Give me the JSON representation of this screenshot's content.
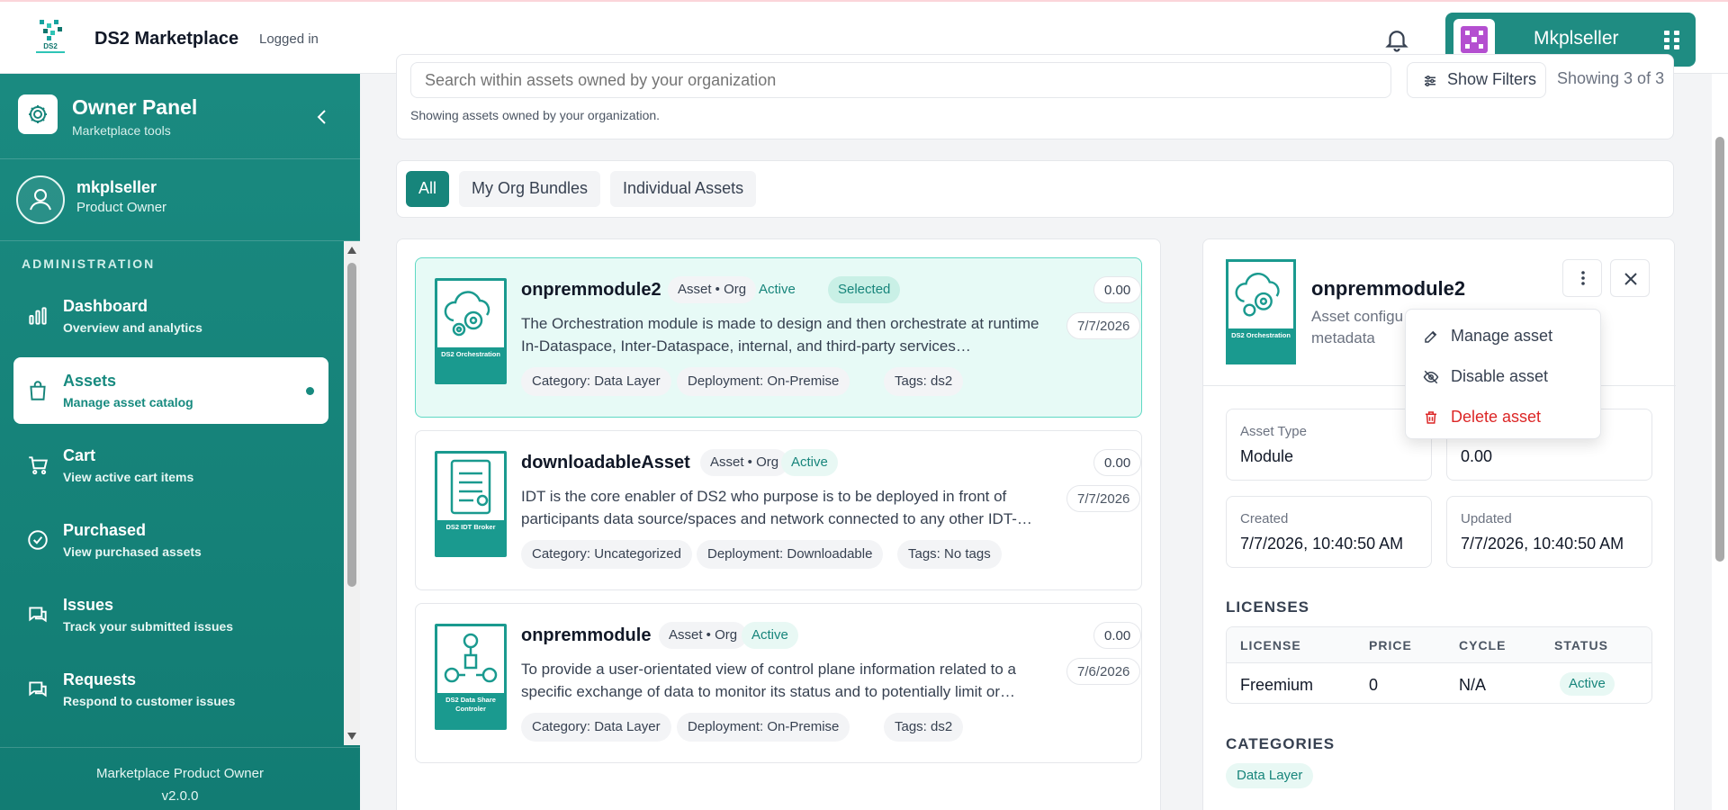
{
  "header": {
    "logo_text": "DS2",
    "app_title": "DS2 Marketplace",
    "login_status": "Logged in",
    "user_name": "Mkplseller"
  },
  "sidebar": {
    "panel_title": "Owner Panel",
    "panel_subtitle": "Marketplace tools",
    "user": {
      "name": "mkplseller",
      "role": "Product Owner"
    },
    "section": "ADMINISTRATION",
    "items": [
      {
        "label": "Dashboard",
        "desc": "Overview and analytics",
        "icon": "bar-chart-icon"
      },
      {
        "label": "Assets",
        "desc": "Manage asset catalog",
        "icon": "shopping-bag-icon",
        "active": true
      },
      {
        "label": "Cart",
        "desc": "View active cart items",
        "icon": "cart-icon"
      },
      {
        "label": "Purchased",
        "desc": "View purchased assets",
        "icon": "check-circle-icon"
      },
      {
        "label": "Issues",
        "desc": "Track your submitted issues",
        "icon": "chat-icon"
      },
      {
        "label": "Requests",
        "desc": "Respond to customer issues",
        "icon": "chat-icon"
      }
    ],
    "footer": {
      "title": "Marketplace Product Owner",
      "version": "v2.0.0"
    }
  },
  "search": {
    "placeholder": "Search within assets owned by your organization",
    "filters_label": "Show Filters",
    "showing": "Showing 3 of 3",
    "info": "Showing assets owned by your organization."
  },
  "tabs": [
    {
      "label": "All",
      "active": true
    },
    {
      "label": "My Org Bundles"
    },
    {
      "label": "Individual Assets"
    }
  ],
  "assets": [
    {
      "name": "onpremmodule2",
      "scope": "Asset • Org",
      "status": "Active",
      "selected_label": "Selected",
      "price": "0.00",
      "date": "7/7/2026",
      "description": "The Orchestration module is made to design and then orchestrate at runtime In-Dataspace, Inter-Dataspace, internal, and third-party services…",
      "category": "Category: Data Layer",
      "deployment": "Deployment: On-Premise",
      "tags": "Tags: ds2",
      "thumb_caption": "DS2 Orchestration"
    },
    {
      "name": "downloadableAsset",
      "scope": "Asset • Org",
      "status": "Active",
      "price": "0.00",
      "date": "7/7/2026",
      "description": "IDT is the core enabler of DS2 who purpose is to be deployed in front of participants data source/spaces and network connected to any other IDT-…",
      "category": "Category: Uncategorized",
      "deployment": "Deployment: Downloadable",
      "tags": "Tags: No tags",
      "thumb_caption": "DS2 IDT Broker"
    },
    {
      "name": "onpremmodule",
      "scope": "Asset • Org",
      "status": "Active",
      "price": "0.00",
      "date": "7/6/2026",
      "description": "To provide a user-orientated view of control plane information related to a specific exchange of data to monitor its status and to potentially limit or…",
      "category": "Category: Data Layer",
      "deployment": "Deployment: On-Premise",
      "tags": "Tags: ds2",
      "thumb_caption": "DS2 Data Share Controler"
    }
  ],
  "detail": {
    "name": "onpremmodule2",
    "subtitle": "Asset configu metadata",
    "thumb_caption": "DS2 Orchestration",
    "fields": [
      {
        "label": "Asset Type",
        "value": "Module"
      },
      {
        "label": "",
        "value": "0.00"
      },
      {
        "label": "Created",
        "value": "7/7/2026, 10:40:50 AM"
      },
      {
        "label": "Updated",
        "value": "7/7/2026, 10:40:50 AM"
      }
    ],
    "licenses_title": "LICENSES",
    "license_columns": [
      "LICENSE",
      "PRICE",
      "CYCLE",
      "STATUS"
    ],
    "license_row": {
      "license": "Freemium",
      "price": "0",
      "cycle": "N/A",
      "status": "Active"
    },
    "categories_title": "CATEGORIES",
    "category": "Data Layer"
  },
  "menu": {
    "items": [
      {
        "label": "Manage asset",
        "icon": "edit-icon"
      },
      {
        "label": "Disable asset",
        "icon": "eye-off-icon"
      },
      {
        "label": "Delete asset",
        "icon": "trash-icon",
        "danger": true
      }
    ]
  },
  "colors": {
    "accent": "#17857b",
    "sidebar": "#1a8a80",
    "danger": "#dc2626",
    "selected_bg": "#e7faf6"
  }
}
